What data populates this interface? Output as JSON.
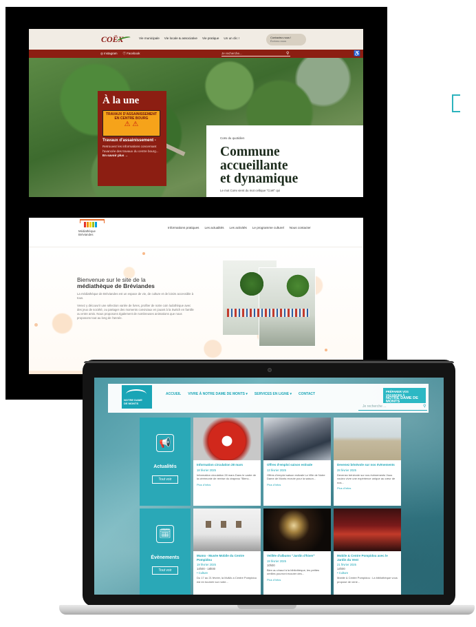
{
  "coex": {
    "logo": "COËX",
    "nav": [
      "Vie municipale",
      "Vie locale & associative",
      "Vie pratique",
      "Un un clic !"
    ],
    "contact_label": "Contactez-nous !",
    "contact_sub": "Écrivez-nous",
    "social": [
      "Instagram",
      "Facebook"
    ],
    "search_placeholder": "Je recherche...",
    "card_title": "À la une",
    "sign_text": "TRAVAUX D'ASSAINISSEMENT\nEN CENTRE BOURG",
    "sign_icons": "⚠ ⚠",
    "card_subtitle": "Travaux d'assainissement -",
    "card_text": "Retrouvez les informations concernant l'avancée des travaux du centre bourg...",
    "card_more": "En savoir plus →",
    "kicker": "Coëx du quotidien",
    "headline": "Commune\naccueillante\net dynamique",
    "lead": "Le mot Coëx vient du mot celtique \"Coët\" qui"
  },
  "media": {
    "logo_text": "Médiathèque\nBréviandes",
    "logo_colors": [
      "#e4332a",
      "#f39200",
      "#ffd500",
      "#95c11f",
      "#009fe3"
    ],
    "nav": [
      "Informations pratiques",
      "Les actualités",
      "Les activités",
      "Le programme culturel",
      "Nous contacter"
    ],
    "welcome_prefix": "Bienvenue sur le site de la",
    "welcome_strong": "médiathèque de Bréviandes",
    "p1": "La médiathèque de Bréviandes est un espace de vie, de culture et de loisirs accessible à tous.",
    "p2": "Venez y découvrir une sélection variée de livres, profiter de notre coin ludothèque avec des jeux de société, ou partager des moments conviviaux en jouant à la Switch en famille ou entre amis. Nous proposons également de nombreuses animations que nous proposons tout au long de l'année."
  },
  "ndm": {
    "logo_text": "NOTRE DAME\nDE MONTS",
    "nav": [
      "ACCUEIL",
      "VIVRE À NOTRE DAME DE MONTS ▾",
      "SERVICES EN LIGNE ▾",
      "CONTACT"
    ],
    "cta": "PRÉPARER VOS VACANCES À",
    "cta_strong": "NOTRE DAME DE MONTS",
    "search_placeholder": "Je recherche ...",
    "tile_news": {
      "icon": "📢",
      "title": "Actualités",
      "button": "Tout voir"
    },
    "tile_events": {
      "icon": "🗓",
      "title": "Évènements",
      "button": "Tout voir"
    },
    "cards": [
      {
        "title": "Information circulation 28 mars",
        "date": "18 février 2025",
        "text": "Information circulation 28 mars Dans le cadre de la cérémonie de remise du drapeau \"Bienv...",
        "more": "Plus d'infos"
      },
      {
        "title": "Offres d'emploi saison estivale",
        "date": "13 février 2025",
        "text": "Offres d'emploi saison estivale La Ville de Notre Dame de Monts recrute pour la saison...",
        "more": "Plus d'infos"
      },
      {
        "title": "Devenez bénévole sur nos évènements",
        "date": "28 février 2025",
        "text": "Devenez bénévole sur nos évènements Vous voulez vivre une expérience unique au cœur de nos...",
        "more": "Plus d'infos"
      },
      {
        "title": "Mumo - Musée Mobile du Centre Pompidou",
        "date": "19 février 2025",
        "time": "14h00 - 18h00",
        "category": "• Culture",
        "text": "Du 17 au 21 février, la MuMo a Centre Pompidou est en tournée sur notre...",
        "more": "Plus d'infos"
      },
      {
        "title": "Veillée d'albums \"Jardin d'hiver\"",
        "date": "19 février 2025",
        "time": "10h00",
        "category": "",
        "text": "Bien au chaud à la bibliothèque, les petites oreilles pourront écouter des...",
        "more": "Plus d'infos"
      },
      {
        "title": "Mobile & Centre Pompidou avec le Jardin du Vent",
        "date": "21 février 2025",
        "time": "14h00",
        "category": "• Culture",
        "text": "Mobile & Centre Pompidou : La bibliothèque vous propose de venir...",
        "more": ""
      }
    ]
  },
  "colors": {
    "coex_red": "#8c1e12",
    "teal": "#2aa8b7",
    "media_orange": "#e86b2a"
  }
}
